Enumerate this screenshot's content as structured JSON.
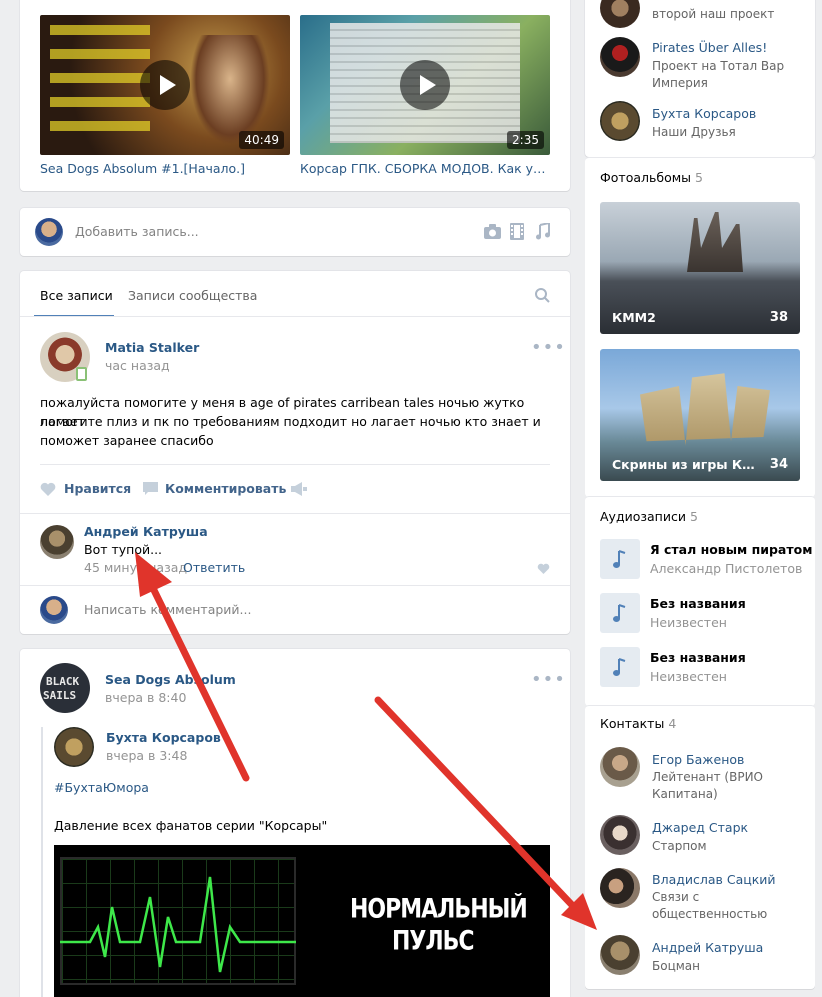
{
  "videos": [
    {
      "title": "Sea Dogs Absolum #1.[Начало.]",
      "duration": "40:49"
    },
    {
      "title": "Корсар ГПК. СБОРКА МОДОВ. Как установить",
      "duration": "2:35"
    }
  ],
  "composer": {
    "placeholder": "Добавить запись..."
  },
  "tabs": {
    "all": "Все записи",
    "community": "Записи сообщества"
  },
  "post1": {
    "author": "Matia Stalker",
    "time": "час назад",
    "text_lines": [
      "пожалуйста помогите у меня в age of pirates carribean tales ночью жутко лагает",
      "помогите плиз и пк по требованиям подходит но лагает ночью кто знает и",
      "поможет заранее спасибо"
    ],
    "like_label": "Нравится",
    "comment_label": "Комментировать"
  },
  "comment": {
    "author": "Андрей Катруша",
    "text": "Вот тупой...",
    "time": "45 минут назад",
    "reply_label": "Ответить"
  },
  "write_comment": {
    "placeholder": "Написать комментарий..."
  },
  "post2": {
    "author": "Sea Dogs Absolum",
    "time": "вчера в 8:40",
    "repost_author": "Бухта Корсаров",
    "repost_time": "вчера в 3:48",
    "hashtag": "#БухтаЮмора",
    "text": "Давление всех фанатов серии \"Корсары\"",
    "image_caption_line1": "НОРМАЛЬНЫЙ",
    "image_caption_line2": "ПУЛЬС",
    "avatar_text_1": "BLACK",
    "avatar_text_2": "SAILS"
  },
  "groups": [
    {
      "name": "",
      "sub": "второй наш проект"
    },
    {
      "name": "Pirates Über Alles!",
      "sub": "Проект на Тотал Вар Империя"
    },
    {
      "name": "Бухта Корсаров",
      "sub": "Наши Друзья"
    }
  ],
  "albums": {
    "title": "Фотоальбомы",
    "count": "5",
    "items": [
      {
        "label": "КММ2",
        "count": "38"
      },
      {
        "label": "Скрины из игры Корсары",
        "count": "34"
      }
    ]
  },
  "audio": {
    "title": "Аудиозаписи",
    "count": "5",
    "items": [
      {
        "title": "Я стал новым пиратом",
        "artist": "Александр Пистолетов"
      },
      {
        "title": "Без названия",
        "artist": "Неизвестен"
      },
      {
        "title": "Без названия",
        "artist": "Неизвестен"
      }
    ]
  },
  "contacts": {
    "title": "Контакты",
    "count": "4",
    "items": [
      {
        "name": "Егор Баженов",
        "role": "Лейтенант (ВРИО Капитана)"
      },
      {
        "name": "Джаред Старк",
        "role": "Старпом"
      },
      {
        "name": "Владислав Сацкий",
        "role": "Связи с общественностью"
      },
      {
        "name": "Андрей Катруша",
        "role": "Боцман"
      }
    ]
  },
  "colors": {
    "accent": "#2a5885",
    "arrow": "#e0342b",
    "bg": "#edeef0"
  }
}
